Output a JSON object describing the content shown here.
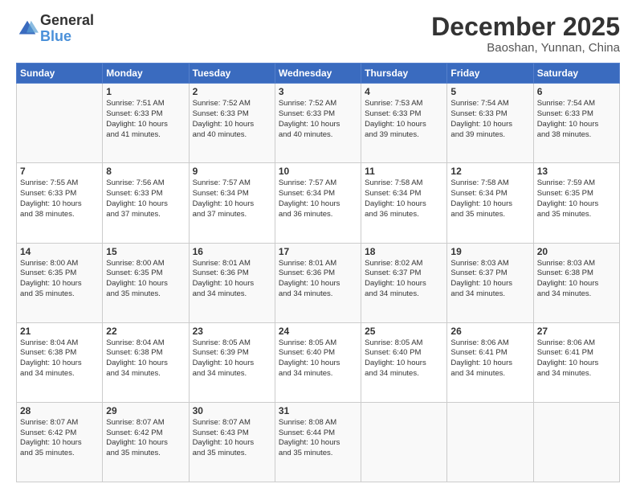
{
  "header": {
    "logo_general": "General",
    "logo_blue": "Blue",
    "month_title": "December 2025",
    "location": "Baoshan, Yunnan, China"
  },
  "days_of_week": [
    "Sunday",
    "Monday",
    "Tuesday",
    "Wednesday",
    "Thursday",
    "Friday",
    "Saturday"
  ],
  "weeks": [
    [
      {
        "day": "",
        "sunrise": "",
        "sunset": "",
        "daylight": ""
      },
      {
        "day": "1",
        "sunrise": "Sunrise: 7:51 AM",
        "sunset": "Sunset: 6:33 PM",
        "daylight": "Daylight: 10 hours and 41 minutes."
      },
      {
        "day": "2",
        "sunrise": "Sunrise: 7:52 AM",
        "sunset": "Sunset: 6:33 PM",
        "daylight": "Daylight: 10 hours and 40 minutes."
      },
      {
        "day": "3",
        "sunrise": "Sunrise: 7:52 AM",
        "sunset": "Sunset: 6:33 PM",
        "daylight": "Daylight: 10 hours and 40 minutes."
      },
      {
        "day": "4",
        "sunrise": "Sunrise: 7:53 AM",
        "sunset": "Sunset: 6:33 PM",
        "daylight": "Daylight: 10 hours and 39 minutes."
      },
      {
        "day": "5",
        "sunrise": "Sunrise: 7:54 AM",
        "sunset": "Sunset: 6:33 PM",
        "daylight": "Daylight: 10 hours and 39 minutes."
      },
      {
        "day": "6",
        "sunrise": "Sunrise: 7:54 AM",
        "sunset": "Sunset: 6:33 PM",
        "daylight": "Daylight: 10 hours and 38 minutes."
      }
    ],
    [
      {
        "day": "7",
        "sunrise": "Sunrise: 7:55 AM",
        "sunset": "Sunset: 6:33 PM",
        "daylight": "Daylight: 10 hours and 38 minutes."
      },
      {
        "day": "8",
        "sunrise": "Sunrise: 7:56 AM",
        "sunset": "Sunset: 6:33 PM",
        "daylight": "Daylight: 10 hours and 37 minutes."
      },
      {
        "day": "9",
        "sunrise": "Sunrise: 7:57 AM",
        "sunset": "Sunset: 6:34 PM",
        "daylight": "Daylight: 10 hours and 37 minutes."
      },
      {
        "day": "10",
        "sunrise": "Sunrise: 7:57 AM",
        "sunset": "Sunset: 6:34 PM",
        "daylight": "Daylight: 10 hours and 36 minutes."
      },
      {
        "day": "11",
        "sunrise": "Sunrise: 7:58 AM",
        "sunset": "Sunset: 6:34 PM",
        "daylight": "Daylight: 10 hours and 36 minutes."
      },
      {
        "day": "12",
        "sunrise": "Sunrise: 7:58 AM",
        "sunset": "Sunset: 6:34 PM",
        "daylight": "Daylight: 10 hours and 35 minutes."
      },
      {
        "day": "13",
        "sunrise": "Sunrise: 7:59 AM",
        "sunset": "Sunset: 6:35 PM",
        "daylight": "Daylight: 10 hours and 35 minutes."
      }
    ],
    [
      {
        "day": "14",
        "sunrise": "Sunrise: 8:00 AM",
        "sunset": "Sunset: 6:35 PM",
        "daylight": "Daylight: 10 hours and 35 minutes."
      },
      {
        "day": "15",
        "sunrise": "Sunrise: 8:00 AM",
        "sunset": "Sunset: 6:35 PM",
        "daylight": "Daylight: 10 hours and 35 minutes."
      },
      {
        "day": "16",
        "sunrise": "Sunrise: 8:01 AM",
        "sunset": "Sunset: 6:36 PM",
        "daylight": "Daylight: 10 hours and 34 minutes."
      },
      {
        "day": "17",
        "sunrise": "Sunrise: 8:01 AM",
        "sunset": "Sunset: 6:36 PM",
        "daylight": "Daylight: 10 hours and 34 minutes."
      },
      {
        "day": "18",
        "sunrise": "Sunrise: 8:02 AM",
        "sunset": "Sunset: 6:37 PM",
        "daylight": "Daylight: 10 hours and 34 minutes."
      },
      {
        "day": "19",
        "sunrise": "Sunrise: 8:03 AM",
        "sunset": "Sunset: 6:37 PM",
        "daylight": "Daylight: 10 hours and 34 minutes."
      },
      {
        "day": "20",
        "sunrise": "Sunrise: 8:03 AM",
        "sunset": "Sunset: 6:38 PM",
        "daylight": "Daylight: 10 hours and 34 minutes."
      }
    ],
    [
      {
        "day": "21",
        "sunrise": "Sunrise: 8:04 AM",
        "sunset": "Sunset: 6:38 PM",
        "daylight": "Daylight: 10 hours and 34 minutes."
      },
      {
        "day": "22",
        "sunrise": "Sunrise: 8:04 AM",
        "sunset": "Sunset: 6:38 PM",
        "daylight": "Daylight: 10 hours and 34 minutes."
      },
      {
        "day": "23",
        "sunrise": "Sunrise: 8:05 AM",
        "sunset": "Sunset: 6:39 PM",
        "daylight": "Daylight: 10 hours and 34 minutes."
      },
      {
        "day": "24",
        "sunrise": "Sunrise: 8:05 AM",
        "sunset": "Sunset: 6:40 PM",
        "daylight": "Daylight: 10 hours and 34 minutes."
      },
      {
        "day": "25",
        "sunrise": "Sunrise: 8:05 AM",
        "sunset": "Sunset: 6:40 PM",
        "daylight": "Daylight: 10 hours and 34 minutes."
      },
      {
        "day": "26",
        "sunrise": "Sunrise: 8:06 AM",
        "sunset": "Sunset: 6:41 PM",
        "daylight": "Daylight: 10 hours and 34 minutes."
      },
      {
        "day": "27",
        "sunrise": "Sunrise: 8:06 AM",
        "sunset": "Sunset: 6:41 PM",
        "daylight": "Daylight: 10 hours and 34 minutes."
      }
    ],
    [
      {
        "day": "28",
        "sunrise": "Sunrise: 8:07 AM",
        "sunset": "Sunset: 6:42 PM",
        "daylight": "Daylight: 10 hours and 35 minutes."
      },
      {
        "day": "29",
        "sunrise": "Sunrise: 8:07 AM",
        "sunset": "Sunset: 6:42 PM",
        "daylight": "Daylight: 10 hours and 35 minutes."
      },
      {
        "day": "30",
        "sunrise": "Sunrise: 8:07 AM",
        "sunset": "Sunset: 6:43 PM",
        "daylight": "Daylight: 10 hours and 35 minutes."
      },
      {
        "day": "31",
        "sunrise": "Sunrise: 8:08 AM",
        "sunset": "Sunset: 6:44 PM",
        "daylight": "Daylight: 10 hours and 35 minutes."
      },
      {
        "day": "",
        "sunrise": "",
        "sunset": "",
        "daylight": ""
      },
      {
        "day": "",
        "sunrise": "",
        "sunset": "",
        "daylight": ""
      },
      {
        "day": "",
        "sunrise": "",
        "sunset": "",
        "daylight": ""
      }
    ]
  ]
}
